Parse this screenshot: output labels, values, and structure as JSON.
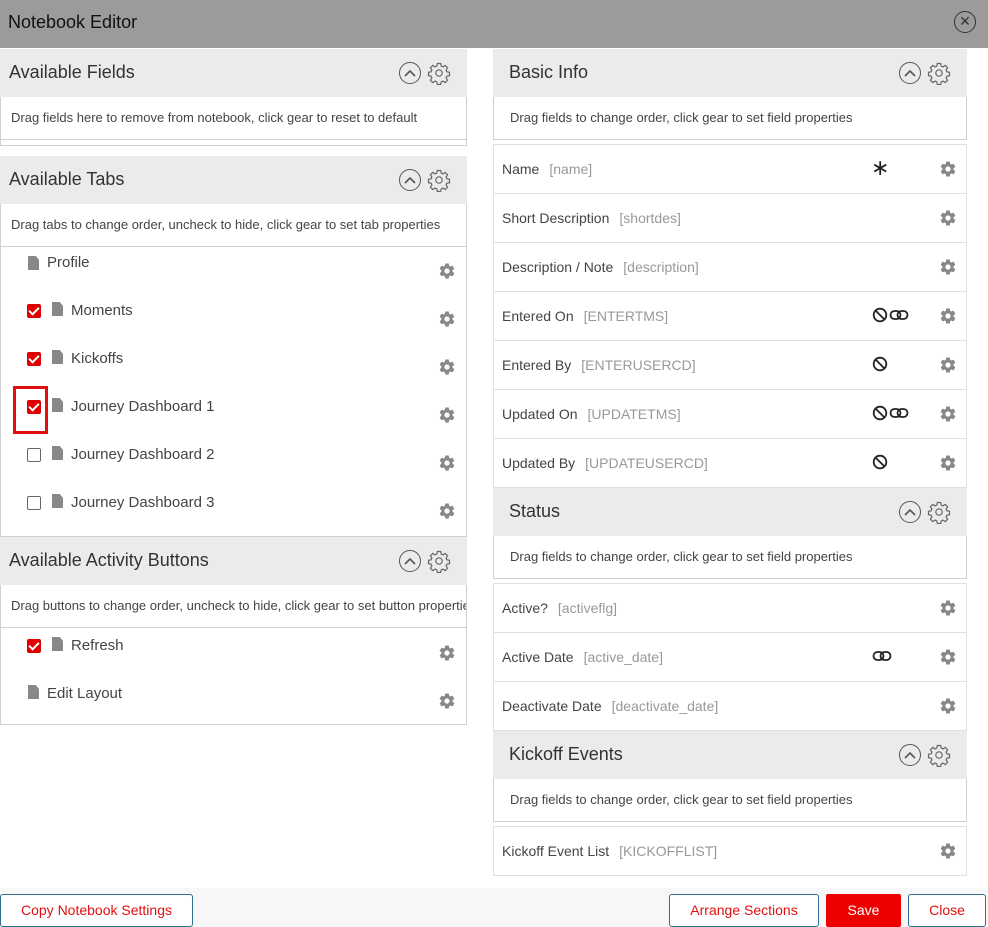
{
  "window": {
    "title": "Notebook Editor",
    "close_icon": "close-circle-icon"
  },
  "left": {
    "available_fields": {
      "title": "Available Fields",
      "description": "Drag fields here to remove from notebook, click gear to reset to default"
    },
    "available_tabs": {
      "title": "Available Tabs",
      "description": "Drag tabs to change order, uncheck to hide, click gear to set tab properties",
      "items": [
        {
          "label": "Profile",
          "has_checkbox": false,
          "checked": false
        },
        {
          "label": "Moments",
          "has_checkbox": true,
          "checked": true
        },
        {
          "label": "Kickoffs",
          "has_checkbox": true,
          "checked": true
        },
        {
          "label": "Journey Dashboard 1",
          "has_checkbox": true,
          "checked": true,
          "highlighted": true
        },
        {
          "label": "Journey Dashboard 2",
          "has_checkbox": true,
          "checked": false
        },
        {
          "label": "Journey Dashboard 3",
          "has_checkbox": true,
          "checked": false
        }
      ]
    },
    "activity_buttons": {
      "title": "Available Activity Buttons",
      "description": "Drag buttons to change order, uncheck to hide, click gear to set button properties",
      "items": [
        {
          "label": "Refresh",
          "has_checkbox": true,
          "checked": true
        },
        {
          "label": "Edit Layout",
          "has_checkbox": false,
          "checked": false
        }
      ]
    }
  },
  "right": {
    "basic_info": {
      "title": "Basic Info",
      "description": "Drag fields to change order, click gear to set field properties",
      "fields": [
        {
          "name": "Name",
          "key": "[name]",
          "icons": [
            "required-asterisk-icon"
          ]
        },
        {
          "name": "Short Description",
          "key": "[shortdes]",
          "icons": []
        },
        {
          "name": "Description / Note",
          "key": "[description]",
          "icons": []
        },
        {
          "name": "Entered On",
          "key": "[ENTERTMS]",
          "icons": [
            "no-entry-icon",
            "link-icon"
          ]
        },
        {
          "name": "Entered By",
          "key": "[ENTERUSERCD]",
          "icons": [
            "no-entry-icon"
          ]
        },
        {
          "name": "Updated On",
          "key": "[UPDATETMS]",
          "icons": [
            "no-entry-icon",
            "link-icon"
          ]
        },
        {
          "name": "Updated By",
          "key": "[UPDATEUSERCD]",
          "icons": [
            "no-entry-icon"
          ]
        }
      ]
    },
    "status": {
      "title": "Status",
      "description": "Drag fields to change order, click gear to set field properties",
      "fields": [
        {
          "name": "Active?",
          "key": "[activeflg]",
          "icons": []
        },
        {
          "name": "Active Date",
          "key": "[active_date]",
          "icons": [
            "link-icon"
          ]
        },
        {
          "name": "Deactivate Date",
          "key": "[deactivate_date]",
          "icons": []
        }
      ]
    },
    "kickoff_events": {
      "title": "Kickoff Events",
      "description": "Drag fields to change order, click gear to set field properties",
      "fields": [
        {
          "name": "Kickoff Event List",
          "key": "[KICKOFFLIST]",
          "icons": []
        }
      ]
    }
  },
  "footer": {
    "copy_label": "Copy Notebook Settings",
    "arrange_label": "Arrange Sections",
    "save_label": "Save",
    "close_label": "Close"
  },
  "colors": {
    "accent_red": "#ee0000",
    "header_gray": "#9b9b9b",
    "section_gray": "#ebebeb"
  }
}
